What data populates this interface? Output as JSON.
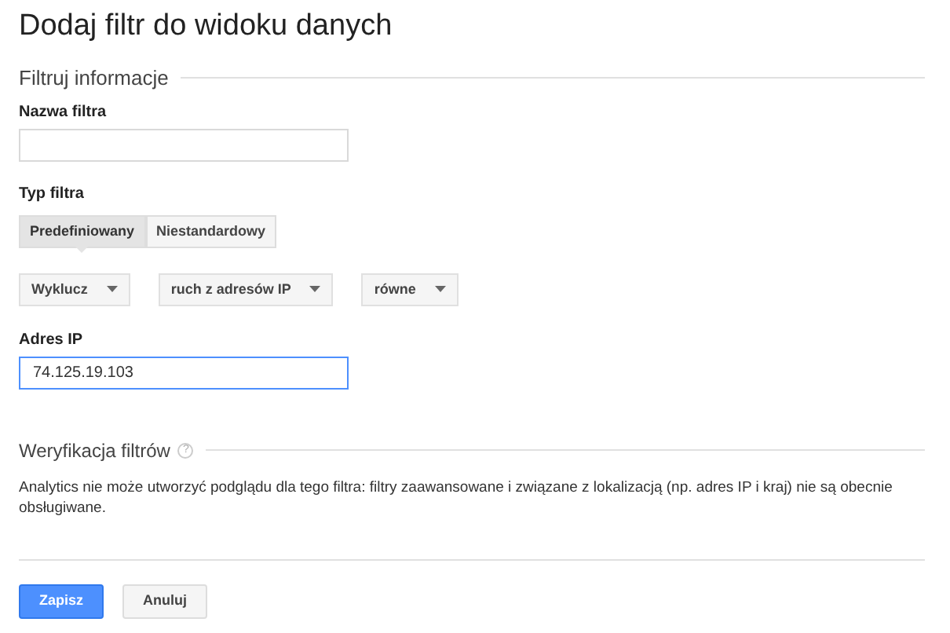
{
  "title": "Dodaj filtr do widoku danych",
  "section_info": {
    "heading": "Filtruj informacje"
  },
  "filter_name": {
    "label": "Nazwa filtra"
  },
  "filter_type": {
    "label": "Typ filtra",
    "tabs": [
      {
        "label": "Predefiniowany",
        "selected": true
      },
      {
        "label": "Niestandardowy",
        "selected": false
      }
    ]
  },
  "dropdowns": [
    {
      "value": "Wyklucz"
    },
    {
      "value": "ruch z adresów IP"
    },
    {
      "value": "równe"
    }
  ],
  "ip_address": {
    "label": "Adres IP",
    "value": "74.125.19.103",
    "focused": true
  },
  "verification": {
    "heading": "Weryfikacja filtrów",
    "help": "?",
    "message": "Analytics nie może utworzyć podglądu dla tego filtra: filtry zaawansowane i związane z lokalizacją (np. adres IP i kraj) nie są obecnie obsługiwane."
  },
  "buttons": [
    {
      "label": "Zapisz",
      "kind": "primary"
    },
    {
      "label": "Anuluj",
      "kind": "secondary"
    }
  ]
}
